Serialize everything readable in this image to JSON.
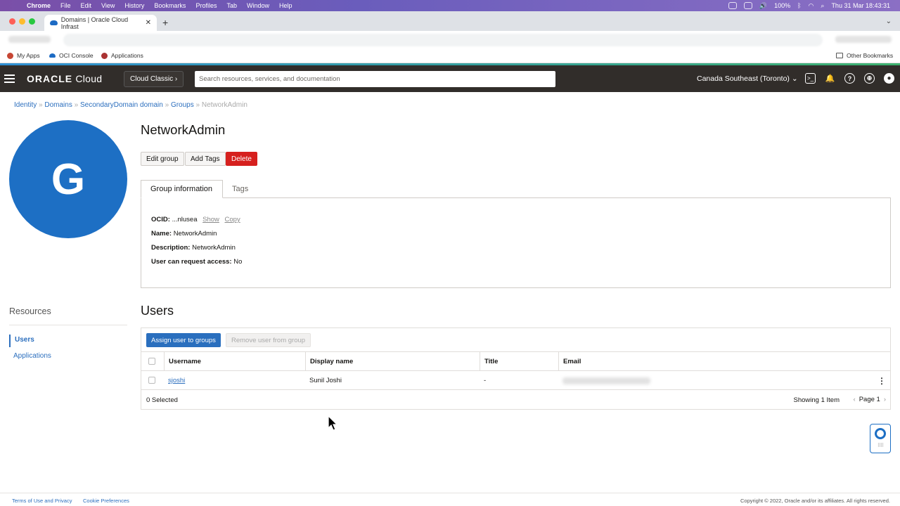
{
  "menubar": {
    "app": "Chrome",
    "items": [
      "File",
      "Edit",
      "View",
      "History",
      "Bookmarks",
      "Profiles",
      "Tab",
      "Window",
      "Help"
    ],
    "battery": "100%",
    "clock": "Thu 31 Mar  18:43:31"
  },
  "browser": {
    "tab_title": "Domains | Oracle Cloud Infrast",
    "bookmarks": [
      "My Apps",
      "OCI Console",
      "Applications"
    ],
    "other_bookmarks": "Other Bookmarks"
  },
  "header": {
    "logo_bold": "ORACLE",
    "logo_light": " Cloud",
    "classic_label": "Cloud Classic",
    "search_placeholder": "Search resources, services, and documentation",
    "region": "Canada Southeast (Toronto)"
  },
  "breadcrumb": {
    "items": [
      "Identity",
      "Domains",
      "SecondaryDomain domain",
      "Groups"
    ],
    "separator": "»",
    "current": "NetworkAdmin"
  },
  "group": {
    "avatar_letter": "G",
    "title": "NetworkAdmin",
    "actions": {
      "edit": "Edit group",
      "tags": "Add Tags",
      "delete": "Delete"
    }
  },
  "tabs": [
    "Group information",
    "Tags"
  ],
  "info": {
    "ocid_label": "OCID:",
    "ocid_value": "...nlusea",
    "show": "Show",
    "copy": "Copy",
    "name_label": "Name:",
    "name_value": "NetworkAdmin",
    "desc_label": "Description:",
    "desc_value": "NetworkAdmin",
    "access_label": "User can request access:",
    "access_value": "No"
  },
  "resources": {
    "heading": "Resources",
    "items": [
      "Users",
      "Applications"
    ]
  },
  "users": {
    "heading": "Users",
    "assign_button": "Assign user to groups",
    "remove_button": "Remove user from group",
    "columns": [
      "Username",
      "Display name",
      "Title",
      "Email"
    ],
    "rows": [
      {
        "username": "sjoshi",
        "display_name": "Sunil Joshi",
        "title": "-"
      }
    ],
    "selected": "0 Selected",
    "showing": "Showing 1 Item",
    "page": "Page 1"
  },
  "footer": {
    "terms": "Terms of Use and Privacy",
    "cookies": "Cookie Preferences",
    "copyright": "Copyright © 2022, Oracle and/or its affiliates. All rights reserved."
  },
  "colors": {
    "header_bg": "#312d2a",
    "primary_blue": "#2a6fbe",
    "avatar_blue": "#1d6fc4",
    "danger_red": "#d6201e"
  }
}
